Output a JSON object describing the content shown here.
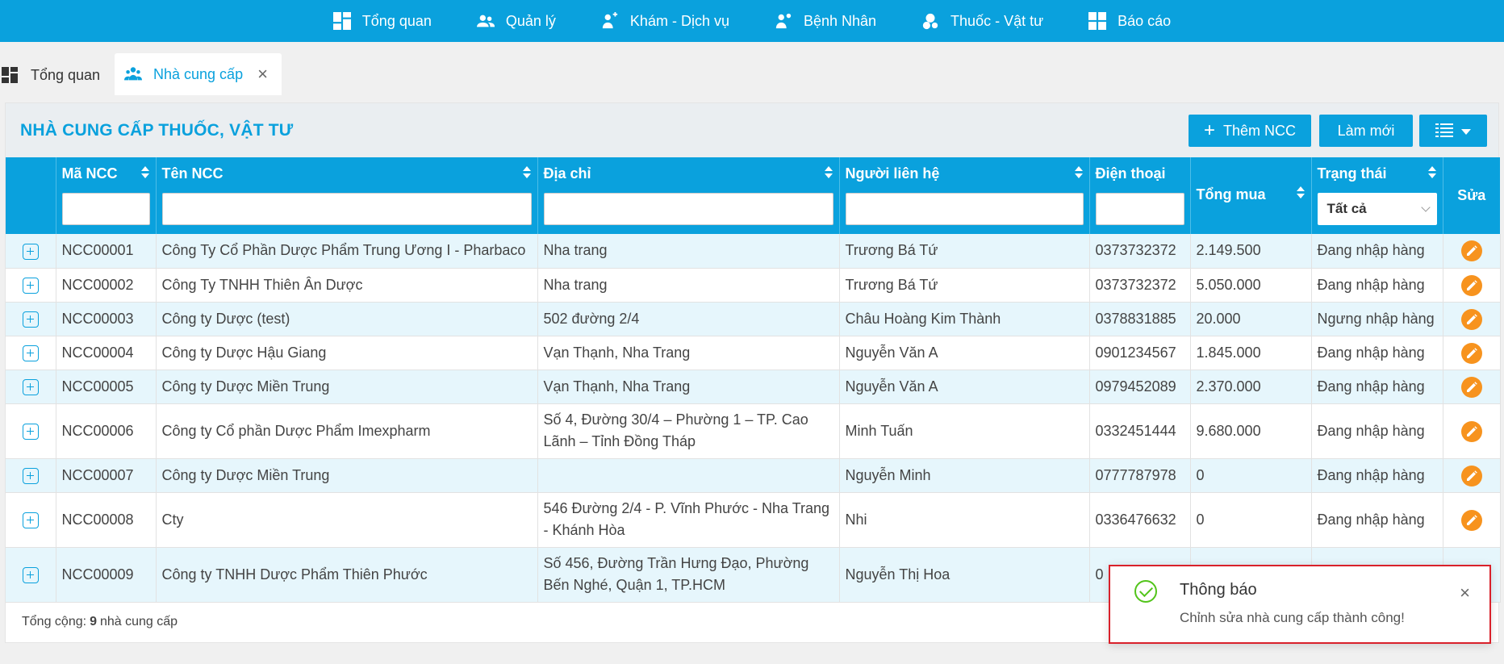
{
  "nav": {
    "items": [
      {
        "label": "Tổng quan",
        "icon": "dashboard-icon"
      },
      {
        "label": "Quản lý",
        "icon": "users-icon"
      },
      {
        "label": "Khám - Dịch vụ",
        "icon": "doctor-icon"
      },
      {
        "label": "Bệnh Nhân",
        "icon": "patient-icon"
      },
      {
        "label": "Thuốc - Vật tư",
        "icon": "medicine-icon"
      },
      {
        "label": "Báo cáo",
        "icon": "report-icon"
      }
    ]
  },
  "tabs": {
    "overview": "Tổng quan",
    "supplier": "Nhà cung cấp",
    "close": "×"
  },
  "panel": {
    "title": "NHÀ CUNG CẤP THUỐC, VẬT TƯ",
    "add_button": "Thêm NCC",
    "refresh_button": "Làm mới"
  },
  "table": {
    "columns": {
      "code": "Mã NCC",
      "name": "Tên NCC",
      "address": "Địa chỉ",
      "contact": "Người liên hệ",
      "phone": "Điện thoại",
      "total": "Tổng mua",
      "status": "Trạng thái",
      "edit": "Sửa"
    },
    "status_filter": "Tất cả",
    "rows": [
      {
        "code": "NCC00001",
        "name": "Công Ty Cổ Phần Dược Phẩm Trung Ương I - Pharbaco",
        "address": "Nha trang",
        "contact": "Trương Bá Tứ",
        "phone": "0373732372",
        "total": "2.149.500",
        "status": "Đang nhập hàng"
      },
      {
        "code": "NCC00002",
        "name": "Công Ty TNHH Thiên Ân Dược",
        "address": "Nha trang",
        "contact": "Trương Bá Tứ",
        "phone": "0373732372",
        "total": "5.050.000",
        "status": "Đang nhập hàng"
      },
      {
        "code": "NCC00003",
        "name": "Công ty Dược (test)",
        "address": "502 đường 2/4",
        "contact": "Châu Hoàng Kim Thành",
        "phone": "0378831885",
        "total": "20.000",
        "status": "Ngưng nhập hàng"
      },
      {
        "code": "NCC00004",
        "name": "Công ty Dược Hậu Giang",
        "address": "Vạn Thạnh, Nha Trang",
        "contact": "Nguyễn Văn A",
        "phone": "0901234567",
        "total": "1.845.000",
        "status": "Đang nhập hàng"
      },
      {
        "code": "NCC00005",
        "name": "Công ty Dược Miền Trung",
        "address": "Vạn Thạnh, Nha Trang",
        "contact": "Nguyễn Văn A",
        "phone": "0979452089",
        "total": "2.370.000",
        "status": "Đang nhập hàng"
      },
      {
        "code": "NCC00006",
        "name": "Công ty Cổ phần Dược Phẩm Imexpharm",
        "address": "Số 4, Đường 30/4 – Phường 1 – TP. Cao Lãnh – Tỉnh Đồng Tháp",
        "contact": "Minh Tuấn",
        "phone": "0332451444",
        "total": "9.680.000",
        "status": "Đang nhập hàng"
      },
      {
        "code": "NCC00007",
        "name": "Công ty Dược Miền Trung",
        "address": "",
        "contact": "Nguyễn Minh",
        "phone": "0777787978",
        "total": "0",
        "status": "Đang nhập hàng"
      },
      {
        "code": "NCC00008",
        "name": "Cty",
        "address": "546 Đường 2/4 - P. Vĩnh Phước - Nha Trang - Khánh Hòa",
        "contact": "Nhi",
        "phone": "0336476632",
        "total": "0",
        "status": "Đang nhập hàng"
      },
      {
        "code": "NCC00009",
        "name": "Công ty TNHH Dược Phẩm Thiên Phước",
        "address": "Số 456, Đường Trần Hưng Đạo, Phường Bến Nghé, Quận 1, TP.HCM",
        "contact": "Nguyễn Thị Hoa",
        "phone": "0",
        "total": "",
        "status": ""
      }
    ]
  },
  "footer": {
    "prefix": "Tổng cộng:",
    "count": "9",
    "suffix": "nhà cung cấp"
  },
  "toast": {
    "title": "Thông báo",
    "message": "Chỉnh sửa nhà cung cấp thành công!",
    "close": "×"
  },
  "colors": {
    "primary": "#0aa1dd",
    "edit": "#f7931e",
    "success": "#52c41a",
    "toast_border": "#d9212b"
  }
}
